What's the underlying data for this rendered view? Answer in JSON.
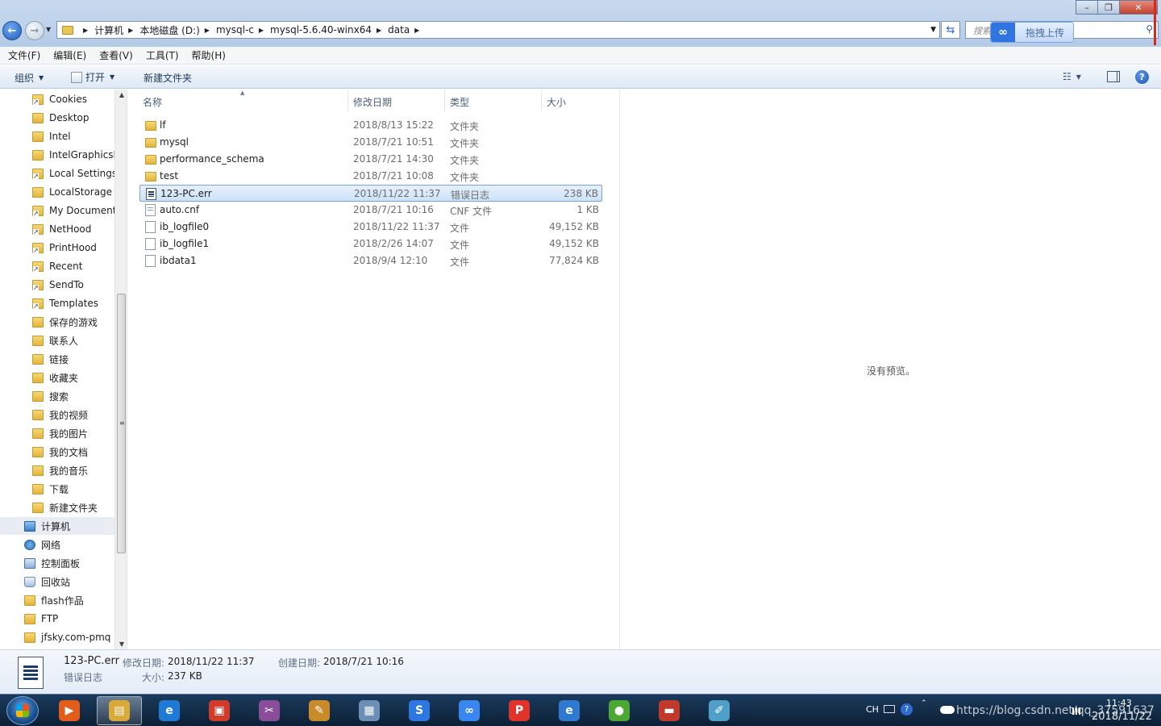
{
  "window": {
    "breadcrumbs": [
      "计算机",
      "本地磁盘 (D:)",
      "mysql-c",
      "mysql-5.6.40-winx64",
      "data"
    ],
    "search_placeholder": "搜索",
    "baidu_upload_label": "拖拽上传",
    "close_glyph": "✕",
    "min_glyph": "–",
    "max_glyph": "❐"
  },
  "menubar": {
    "items": [
      "文件(F)",
      "编辑(E)",
      "查看(V)",
      "工具(T)",
      "帮助(H)"
    ]
  },
  "toolbar": {
    "organize_label": "组织",
    "open_label": "打开",
    "newfolder_label": "新建文件夹",
    "help_glyph": "?"
  },
  "navpane": {
    "items": [
      {
        "label": "Cookies",
        "icon": "shortcut"
      },
      {
        "label": "Desktop",
        "icon": "folder"
      },
      {
        "label": "Intel",
        "icon": "folder"
      },
      {
        "label": "IntelGraphicsP",
        "icon": "folder"
      },
      {
        "label": "Local Settings",
        "icon": "shortcut"
      },
      {
        "label": "LocalStorage",
        "icon": "folder"
      },
      {
        "label": "My Documents",
        "icon": "shortcut"
      },
      {
        "label": "NetHood",
        "icon": "shortcut"
      },
      {
        "label": "PrintHood",
        "icon": "shortcut"
      },
      {
        "label": "Recent",
        "icon": "shortcut"
      },
      {
        "label": "SendTo",
        "icon": "shortcut"
      },
      {
        "label": "Templates",
        "icon": "shortcut"
      },
      {
        "label": "保存的游戏",
        "icon": "folder"
      },
      {
        "label": "联系人",
        "icon": "folder"
      },
      {
        "label": "链接",
        "icon": "folder"
      },
      {
        "label": "收藏夹",
        "icon": "folder"
      },
      {
        "label": "搜索",
        "icon": "folder"
      },
      {
        "label": "我的视频",
        "icon": "folder"
      },
      {
        "label": "我的图片",
        "icon": "folder"
      },
      {
        "label": "我的文档",
        "icon": "folder"
      },
      {
        "label": "我的音乐",
        "icon": "folder"
      },
      {
        "label": "下载",
        "icon": "folder"
      },
      {
        "label": "新建文件夹",
        "icon": "folder"
      },
      {
        "label": "计算机",
        "icon": "computer"
      },
      {
        "label": "网络",
        "icon": "network"
      },
      {
        "label": "控制面板",
        "icon": "control"
      },
      {
        "label": "回收站",
        "icon": "recycle"
      },
      {
        "label": "flash作品",
        "icon": "folder"
      },
      {
        "label": "FTP",
        "icon": "folder"
      },
      {
        "label": "jfsky.com-pmq",
        "icon": "folder"
      }
    ],
    "selected_index": 23
  },
  "filelist": {
    "columns": [
      "名称",
      "修改日期",
      "类型",
      "大小"
    ],
    "rows": [
      {
        "name": "lf",
        "date": "2018/8/13 15:22",
        "type": "文件夹",
        "size": "",
        "icon": "folder"
      },
      {
        "name": "mysql",
        "date": "2018/7/21 10:51",
        "type": "文件夹",
        "size": "",
        "icon": "folder"
      },
      {
        "name": "performance_schema",
        "date": "2018/7/21 14:30",
        "type": "文件夹",
        "size": "",
        "icon": "folder"
      },
      {
        "name": "test",
        "date": "2018/7/21 10:08",
        "type": "文件夹",
        "size": "",
        "icon": "folder"
      },
      {
        "name": "123-PC.err",
        "date": "2018/11/22 11:37",
        "type": "错误日志",
        "size": "238 KB",
        "icon": "errlog"
      },
      {
        "name": "auto.cnf",
        "date": "2018/7/21 10:16",
        "type": "CNF 文件",
        "size": "1 KB",
        "icon": "cnf"
      },
      {
        "name": "ib_logfile0",
        "date": "2018/11/22 11:37",
        "type": "文件",
        "size": "49,152 KB",
        "icon": "blank"
      },
      {
        "name": "ib_logfile1",
        "date": "2018/2/26 14:07",
        "type": "文件",
        "size": "49,152 KB",
        "icon": "blank"
      },
      {
        "name": "ibdata1",
        "date": "2018/9/4 12:10",
        "type": "文件",
        "size": "77,824 KB",
        "icon": "blank"
      }
    ],
    "selected_index": 4
  },
  "preview": {
    "text": "没有预览。"
  },
  "details": {
    "name": "123-PC.err",
    "type": "错误日志",
    "modified_label": "修改日期:",
    "modified_value": "2018/11/22 11:37",
    "size_label": "大小:",
    "size_value": "237 KB",
    "created_label": "创建日期:",
    "created_value": "2018/7/21 10:16"
  },
  "taskbar": {
    "apps": [
      {
        "name": "media-player-icon",
        "color": "#e25c1c",
        "glyph": "▶"
      },
      {
        "name": "explorer-icon",
        "color": "#d9a93a",
        "glyph": "▤"
      },
      {
        "name": "ie-icon",
        "color": "#1f7ad6",
        "glyph": "e"
      },
      {
        "name": "office-icon",
        "color": "#d13b2a",
        "glyph": "▣"
      },
      {
        "name": "snipping-tool-icon",
        "color": "#8a4d9a",
        "glyph": "✂"
      },
      {
        "name": "paint-icon",
        "color": "#c98b2a",
        "glyph": "✎"
      },
      {
        "name": "calculator-icon",
        "color": "#6d8fb6",
        "glyph": "▦"
      },
      {
        "name": "sogou-icon",
        "color": "#2d77e0",
        "glyph": "S"
      },
      {
        "name": "baidu-netdisk-icon",
        "color": "#3a86f0",
        "glyph": "∞"
      },
      {
        "name": "wps-pdf-icon",
        "color": "#e0332a",
        "glyph": "P"
      },
      {
        "name": "ie-blue-icon",
        "color": "#2e7ad1",
        "glyph": "e"
      },
      {
        "name": "green-app-icon",
        "color": "#4ba832",
        "glyph": "●"
      },
      {
        "name": "toolbox-icon",
        "color": "#c0392b",
        "glyph": "▬"
      },
      {
        "name": "notepad-icon",
        "color": "#4f9fc8",
        "glyph": "✐"
      }
    ],
    "active_index": 1,
    "lang": "CH",
    "help_glyph": "?",
    "watermark": "https://blog.csdn.net/qq_37591637",
    "time": "11:43",
    "date": "2018/11/22"
  }
}
